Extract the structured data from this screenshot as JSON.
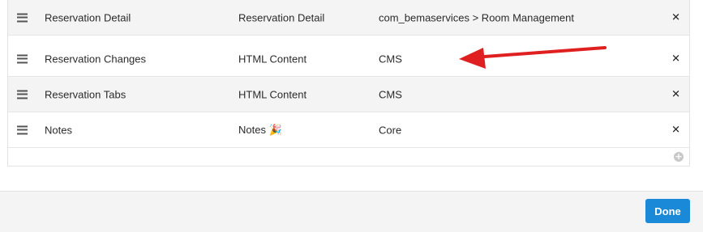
{
  "modules": [
    {
      "name": "Reservation Detail",
      "type": "Reservation Detail",
      "source": "com_bemaservices > Room Management"
    },
    {
      "name": "Reservation Changes",
      "type": "HTML Content",
      "source": "CMS"
    },
    {
      "name": "Reservation Tabs",
      "type": "HTML Content",
      "source": "CMS"
    },
    {
      "name": "Notes",
      "type": "Notes 🎉",
      "source": "Core"
    }
  ],
  "remove_glyph": "✕",
  "add_glyph": "+",
  "footer": {
    "done_label": "Done"
  },
  "colors": {
    "accent": "#1a8ad8",
    "annotation_arrow": "#e02020"
  },
  "icons": [
    "drag-handle-icon",
    "close-icon",
    "add-circle-icon",
    "red-arrow-annotation"
  ]
}
